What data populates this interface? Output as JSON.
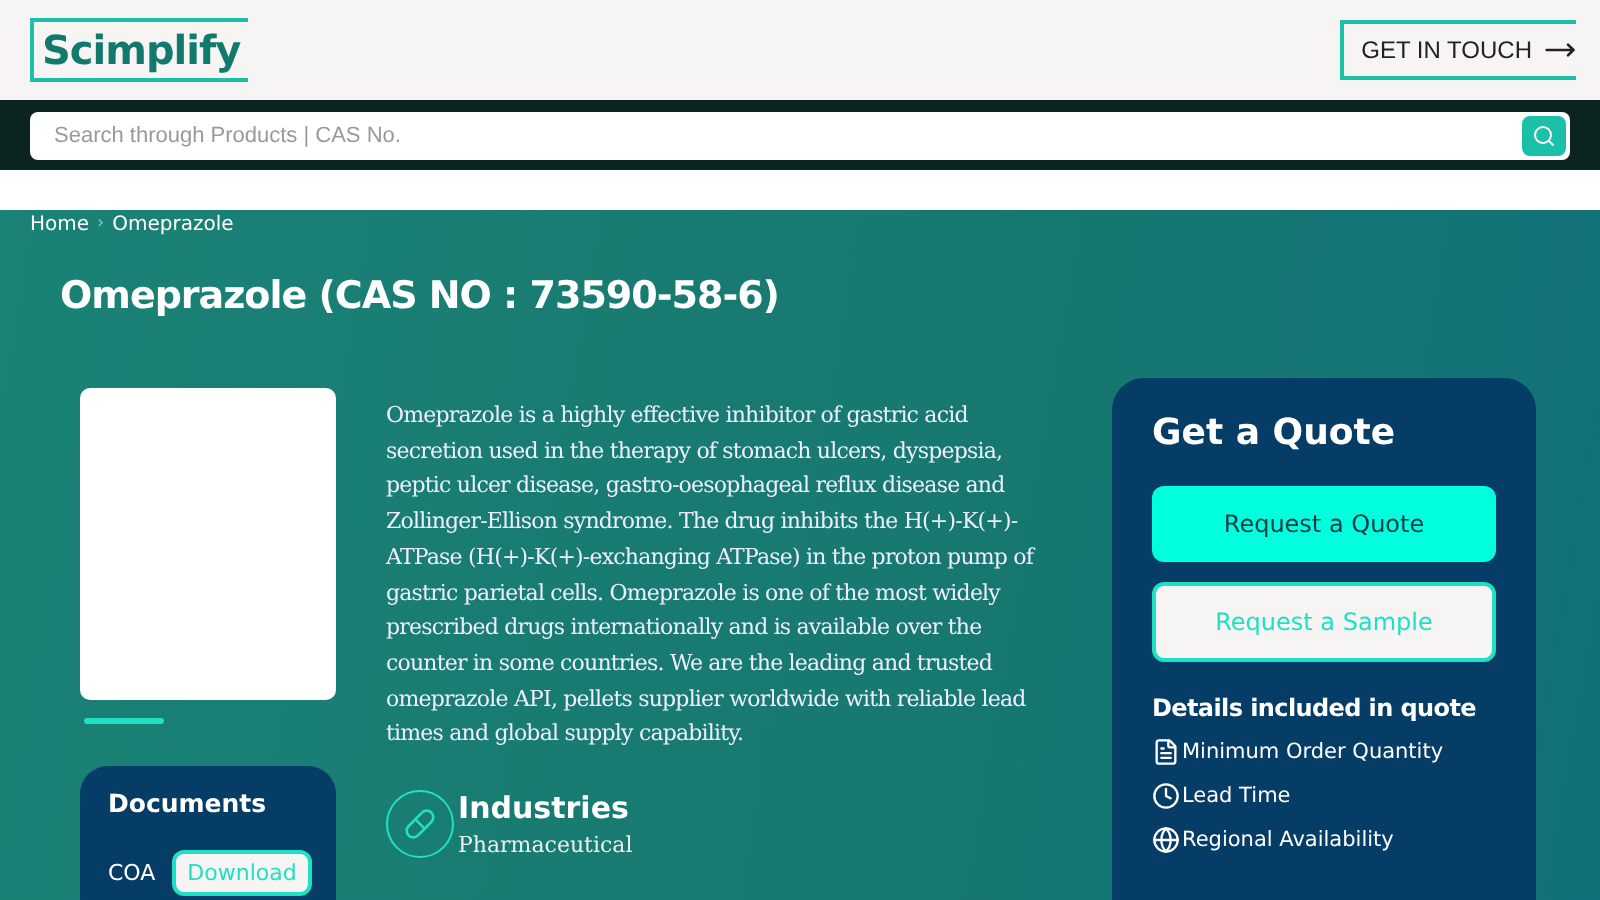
{
  "header": {
    "logo": "Scimplify",
    "cta": "GET IN TOUCH"
  },
  "search": {
    "placeholder": "Search through Products | CAS No."
  },
  "breadcrumb": [
    {
      "label": "Home"
    },
    {
      "label": "Omeprazole"
    }
  ],
  "breadcrumb_separator": "›",
  "title": "Omeprazole (CAS NO : 73590-58-6)",
  "gallery": {
    "slides": [
      {
        "selected": true
      }
    ]
  },
  "documents": {
    "title": "Documents",
    "items": [
      {
        "label": "COA",
        "action": "Download"
      }
    ]
  },
  "description": "Omeprazole is a highly effective inhibitor of gastric acid secretion used in the therapy of stomach ulcers, dyspepsia, peptic ulcer disease, gastro-oesophageal reflux disease and Zollinger-Ellison syndrome. The drug inhibits the H(+)-K(+)-ATPase (H(+)-K(+)-exchanging ATPase) in the proton pump of gastric parietal cells. Omeprazole is one of the most widely prescribed drugs internationally and is available over the counter in some countries. We are the leading and trusted omeprazole API, pellets supplier worldwide with reliable lead times and global supply capability.",
  "industries": {
    "title": "Industries",
    "value": "Pharmaceutical"
  },
  "quote": {
    "title": "Get a Quote",
    "buttons": [
      {
        "label": "Request a Quote",
        "kind": "primary"
      },
      {
        "label": "Request a Sample",
        "kind": "outline"
      }
    ],
    "details_title": "Details included in quote",
    "details": [
      {
        "label": "Minimum Order Quantity",
        "kind": "document"
      },
      {
        "label": "Lead Time",
        "kind": "clock"
      },
      {
        "label": "Regional Availability",
        "kind": "globe"
      }
    ]
  }
}
